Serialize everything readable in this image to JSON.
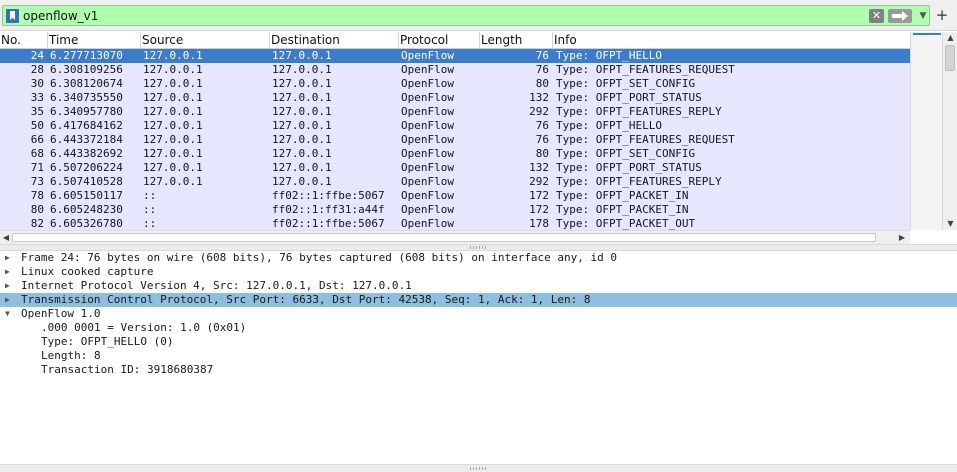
{
  "filter": {
    "value": "openflow_v1",
    "icons": {
      "bookmark": "bookmark-icon",
      "clear": "clear-icon",
      "apply": "arrow-right-icon",
      "recent": "chevron-down-icon",
      "add": "plus-icon"
    },
    "clear_glyph": "✕",
    "recent_glyph": "▼",
    "add_glyph": "+",
    "bg_color": "#afffaf"
  },
  "packet_list": {
    "columns": [
      "No.",
      "Time",
      "Source",
      "Destination",
      "Protocol",
      "Length",
      "Info"
    ],
    "selected_index": 0,
    "rows": [
      {
        "no": "24",
        "time": "6.277713070",
        "src": "127.0.0.1",
        "dst": "127.0.0.1",
        "proto": "OpenFlow",
        "len": "76",
        "info": "Type: OFPT_HELLO"
      },
      {
        "no": "28",
        "time": "6.308109256",
        "src": "127.0.0.1",
        "dst": "127.0.0.1",
        "proto": "OpenFlow",
        "len": "76",
        "info": "Type: OFPT_FEATURES_REQUEST"
      },
      {
        "no": "30",
        "time": "6.308120674",
        "src": "127.0.0.1",
        "dst": "127.0.0.1",
        "proto": "OpenFlow",
        "len": "80",
        "info": "Type: OFPT_SET_CONFIG"
      },
      {
        "no": "33",
        "time": "6.340735550",
        "src": "127.0.0.1",
        "dst": "127.0.0.1",
        "proto": "OpenFlow",
        "len": "132",
        "info": "Type: OFPT_PORT_STATUS"
      },
      {
        "no": "35",
        "time": "6.340957780",
        "src": "127.0.0.1",
        "dst": "127.0.0.1",
        "proto": "OpenFlow",
        "len": "292",
        "info": "Type: OFPT_FEATURES_REPLY"
      },
      {
        "no": "50",
        "time": "6.417684162",
        "src": "127.0.0.1",
        "dst": "127.0.0.1",
        "proto": "OpenFlow",
        "len": "76",
        "info": "Type: OFPT_HELLO"
      },
      {
        "no": "66",
        "time": "6.443372184",
        "src": "127.0.0.1",
        "dst": "127.0.0.1",
        "proto": "OpenFlow",
        "len": "76",
        "info": "Type: OFPT_FEATURES_REQUEST"
      },
      {
        "no": "68",
        "time": "6.443382692",
        "src": "127.0.0.1",
        "dst": "127.0.0.1",
        "proto": "OpenFlow",
        "len": "80",
        "info": "Type: OFPT_SET_CONFIG"
      },
      {
        "no": "71",
        "time": "6.507206224",
        "src": "127.0.0.1",
        "dst": "127.0.0.1",
        "proto": "OpenFlow",
        "len": "132",
        "info": "Type: OFPT_PORT_STATUS"
      },
      {
        "no": "73",
        "time": "6.507410528",
        "src": "127.0.0.1",
        "dst": "127.0.0.1",
        "proto": "OpenFlow",
        "len": "292",
        "info": "Type: OFPT_FEATURES_REPLY"
      },
      {
        "no": "78",
        "time": "6.605150117",
        "src": "::",
        "dst": "ff02::1:ffbe:5067",
        "proto": "OpenFlow",
        "len": "172",
        "info": "Type: OFPT_PACKET_IN"
      },
      {
        "no": "80",
        "time": "6.605248230",
        "src": "::",
        "dst": "ff02::1:ff31:a44f",
        "proto": "OpenFlow",
        "len": "172",
        "info": "Type: OFPT_PACKET_IN"
      },
      {
        "no": "82",
        "time": "6.605326780",
        "src": "::",
        "dst": "ff02::1:ffbe:5067",
        "proto": "OpenFlow",
        "len": "178",
        "info": "Type: OFPT_PACKET_OUT"
      }
    ],
    "colors": {
      "row_bg": "#e7e6ff",
      "selected_bg": "#3c7ccb",
      "selected_fg": "#ffffff"
    },
    "scroll_glyphs": {
      "up": "▲",
      "down": "▼",
      "left": "◀",
      "right": "▶"
    }
  },
  "details": {
    "expanded_glyph": "▼",
    "collapsed_glyph": "▶",
    "items": [
      {
        "text": "Frame 24: 76 bytes on wire (608 bits), 76 bytes captured (608 bits) on interface any, id 0",
        "expanded": false,
        "level": 0
      },
      {
        "text": "Linux cooked capture",
        "expanded": false,
        "level": 0
      },
      {
        "text": "Internet Protocol Version 4, Src: 127.0.0.1, Dst: 127.0.0.1",
        "expanded": false,
        "level": 0
      },
      {
        "text": "Transmission Control Protocol, Src Port: 6633, Dst Port: 42538, Seq: 1, Ack: 1, Len: 8",
        "expanded": false,
        "level": 0,
        "selected": true
      },
      {
        "text": "OpenFlow 1.0",
        "expanded": true,
        "level": 0
      },
      {
        "text": ".000 0001 = Version: 1.0 (0x01)",
        "level": 1
      },
      {
        "text": "Type: OFPT_HELLO (0)",
        "level": 1
      },
      {
        "text": "Length: 8",
        "level": 1
      },
      {
        "text": "Transaction ID: 3918680387",
        "level": 1
      }
    ],
    "selected_bg": "#8fbfe0"
  }
}
